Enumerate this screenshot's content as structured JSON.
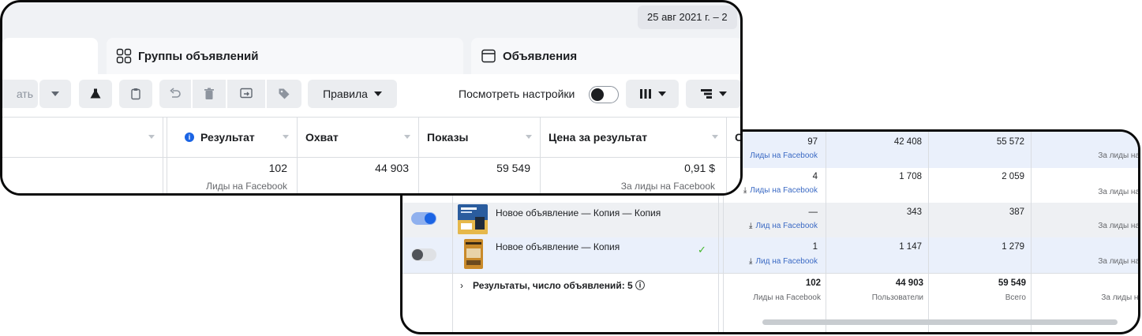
{
  "front": {
    "date_range": "25 авг 2021 г. – 2",
    "tabs": [
      {
        "label": "Группы объявлений"
      },
      {
        "label": "Объявления"
      }
    ],
    "toolbar": {
      "partial_label": "ать",
      "rules_label": "Правила",
      "view_settings_label": "Посмотреть настройки"
    },
    "columns": [
      {
        "label": "Результат"
      },
      {
        "label": "Охват"
      },
      {
        "label": "Показы"
      },
      {
        "label": "Цена за результат"
      },
      {
        "label": "С"
      }
    ],
    "row": {
      "result": "102",
      "result_sub": "Лиды на Facebook",
      "reach": "44 903",
      "impressions": "59 549",
      "cost": "0,91 $",
      "cost_sub": "За лиды на Facebook"
    }
  },
  "back": {
    "rows": [
      {
        "result": "97",
        "result_sub": "Лиды на Facebook",
        "reach": "42 408",
        "impressions": "55 572",
        "cost_sub": "За лиды на"
      },
      {
        "result": "4",
        "result_sub": "Лиды на Facebook",
        "reach": "1 708",
        "impressions": "2 059",
        "cost_sub": "За лиды на"
      },
      {
        "name": "Новое объявление — Копия — Копия",
        "result": "—",
        "result_sub": "Лид на Facebook",
        "reach": "343",
        "impressions": "387",
        "cost_sub": "За лиды на"
      },
      {
        "name": "Новое объявление — Копия",
        "result": "1",
        "result_sub": "Лид на Facebook",
        "reach": "1 147",
        "impressions": "1 279",
        "cost_sub": "За лиды на"
      }
    ],
    "summary": {
      "label": "Результаты, число объявлений: 5",
      "result": "102",
      "result_sub": "Лиды на Facebook",
      "reach": "44 903",
      "reach_sub": "Пользователи",
      "impressions": "59 549",
      "impressions_sub": "Всего",
      "cost_sub": "За лиды на"
    }
  }
}
